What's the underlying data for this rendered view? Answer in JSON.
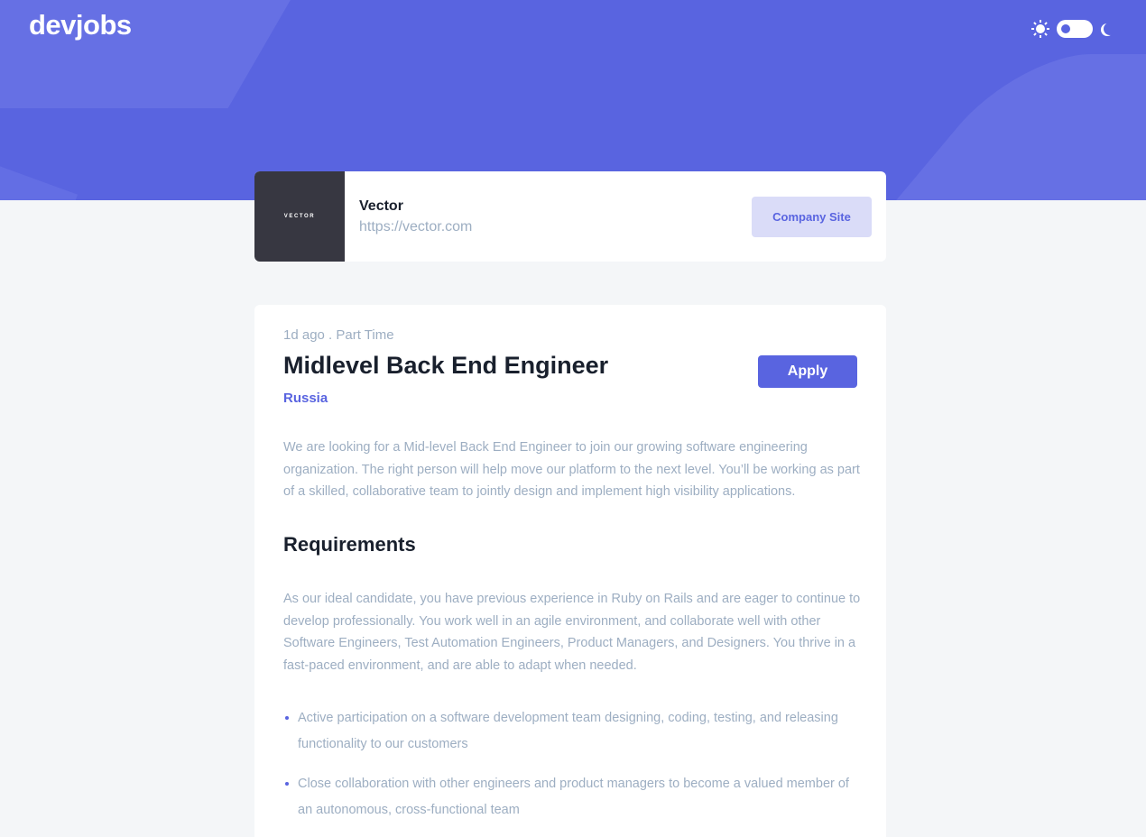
{
  "header": {
    "logo": "devjobs",
    "theme_toggle": {
      "state": "light"
    }
  },
  "company": {
    "logo_text": "VECTOR",
    "name": "Vector",
    "url": "https://vector.com",
    "site_button": "Company Site"
  },
  "job": {
    "meta": "1d ago . Part Time",
    "title": "Midlevel Back End Engineer",
    "location": "Russia",
    "apply_button": "Apply",
    "description": "We are looking for a Mid-level Back End Engineer to join our growing software engineering organization. The right person will help move our platform to the next level. You’ll be working as part of a skilled, collaborative team to jointly design and implement high visibility applications.",
    "requirements": {
      "heading": "Requirements",
      "content": "As our ideal candidate, you have previous experience in Ruby on Rails and are eager to continue to develop professionally. You work well in an agile environment, and collaborate well with other Software Engineers, Test Automation Engineers, Product Managers, and Designers. You thrive in a fast-paced environment, and are able to adapt when needed.",
      "items": [
        "Active participation on a software development team designing, coding, testing, and releasing functionality to our customers",
        "Close collaboration with other engineers and product managers to become a valued member of an autonomous, cross-functional team"
      ]
    }
  },
  "colors": {
    "accent": "#5964e0",
    "accent_light": "#dadcf8",
    "text_dark": "#19202d",
    "text_muted": "#9daec2",
    "background": "#f4f6f8",
    "company_logo_bg": "#373741"
  },
  "icons": [
    "sun-icon",
    "moon-icon",
    "bullet-icon"
  ]
}
